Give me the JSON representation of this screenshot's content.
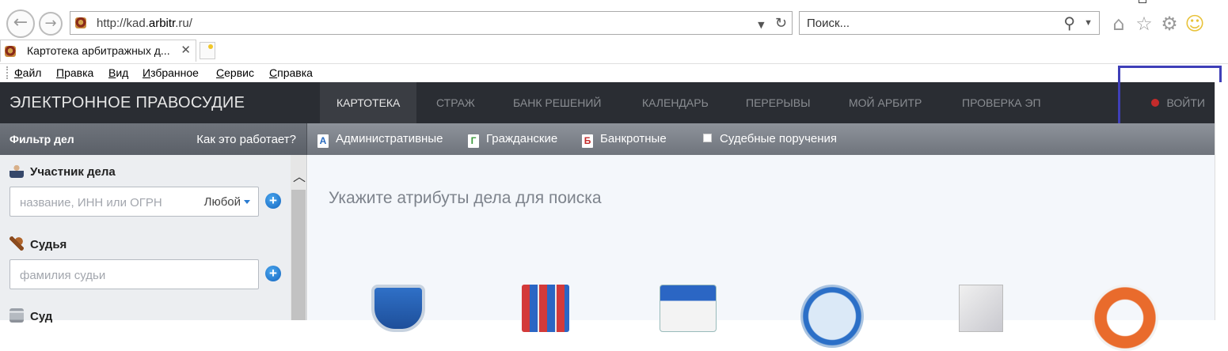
{
  "browser": {
    "address": {
      "prefix": "http://kad.",
      "domain": "arbitr",
      "suffix": ".ru/"
    },
    "search_placeholder": "Поиск...",
    "tab_title": "Картотека арбитражных д...",
    "tab_close": "✕",
    "menu": [
      "Файл",
      "Правка",
      "Вид",
      "Избранное",
      "Сервис",
      "Справка"
    ],
    "icons": [
      "back-icon",
      "forward-icon",
      "refresh-icon",
      "search-icon",
      "home-icon",
      "favorites-star-icon",
      "settings-gear-icon",
      "smiley-feedback-icon"
    ]
  },
  "site": {
    "brand": "ЭЛЕКТРОННОЕ ПРАВОСУДИЕ",
    "nav": [
      "КАРТОТЕКА",
      "СТРАЖ",
      "БАНК РЕШЕНИЙ",
      "КАЛЕНДАРЬ",
      "ПЕРЕРЫВЫ",
      "МОЙ АРБИТР",
      "ПРОВЕРКА ЭП"
    ],
    "active_nav": "КАРТОТЕКА",
    "login": "ВОЙТИ",
    "colors": {
      "header_bg": "#2a2d33",
      "highlight_box": "#3f3fb8",
      "login_dot": "#c42b2b"
    }
  },
  "filterbar": {
    "title": "Фильтр дел",
    "how_it_works": "Как это работает?",
    "categories": [
      {
        "badge": "А",
        "label": "Административные"
      },
      {
        "badge": "Г",
        "label": "Гражданские"
      },
      {
        "badge": "Б",
        "label": "Банкротные"
      }
    ],
    "court_orders_label": "Судебные поручения"
  },
  "sidebar": {
    "participant": {
      "title": "Участник дела",
      "placeholder": "название, ИНН или ОГРН",
      "type_value": "Любой"
    },
    "judge": {
      "title": "Судья",
      "placeholder": "фамилия судьи"
    },
    "court": {
      "title": "Суд"
    }
  },
  "main": {
    "title": "Укажите атрибуты дела для поиска"
  }
}
